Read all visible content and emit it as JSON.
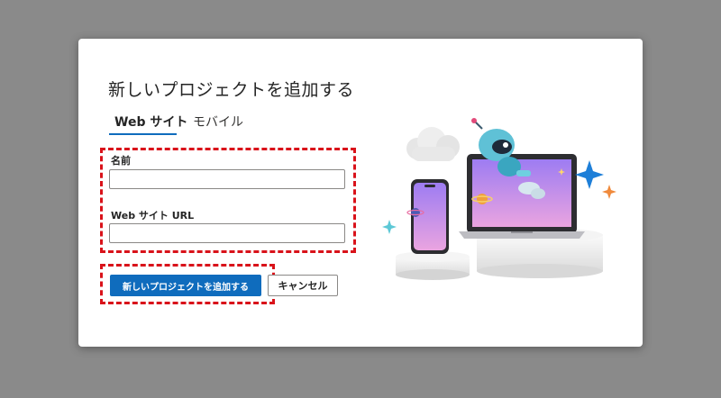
{
  "dialog": {
    "title": "新しいプロジェクトを追加する",
    "tabs": [
      {
        "label": "Web サイト",
        "selected": true
      },
      {
        "label": "モバイル",
        "selected": false
      }
    ],
    "fields": {
      "name": {
        "label": "名前",
        "value": "",
        "placeholder": ""
      },
      "url": {
        "label": "Web サイト URL",
        "value": "",
        "placeholder": ""
      }
    },
    "buttons": {
      "primary_label": "新しいプロジェクトを追加する",
      "cancel_label": "キャンセル"
    },
    "illustration": {
      "icons": [
        "cloud-icon",
        "alien-astronaut-icon",
        "laptop-icon",
        "smartphone-icon",
        "sparkle-icon",
        "planet-icon"
      ]
    }
  },
  "colors": {
    "accent": "#0f6cbd",
    "highlight_dashed_border": "#d9121a",
    "backdrop": "#8a8a8a",
    "sparkle_blue": "#1e7fd8",
    "sparkle_orange": "#f08a3c",
    "screen_gradient_top": "#a67cf0",
    "screen_gradient_bottom": "#e7a0e6"
  }
}
